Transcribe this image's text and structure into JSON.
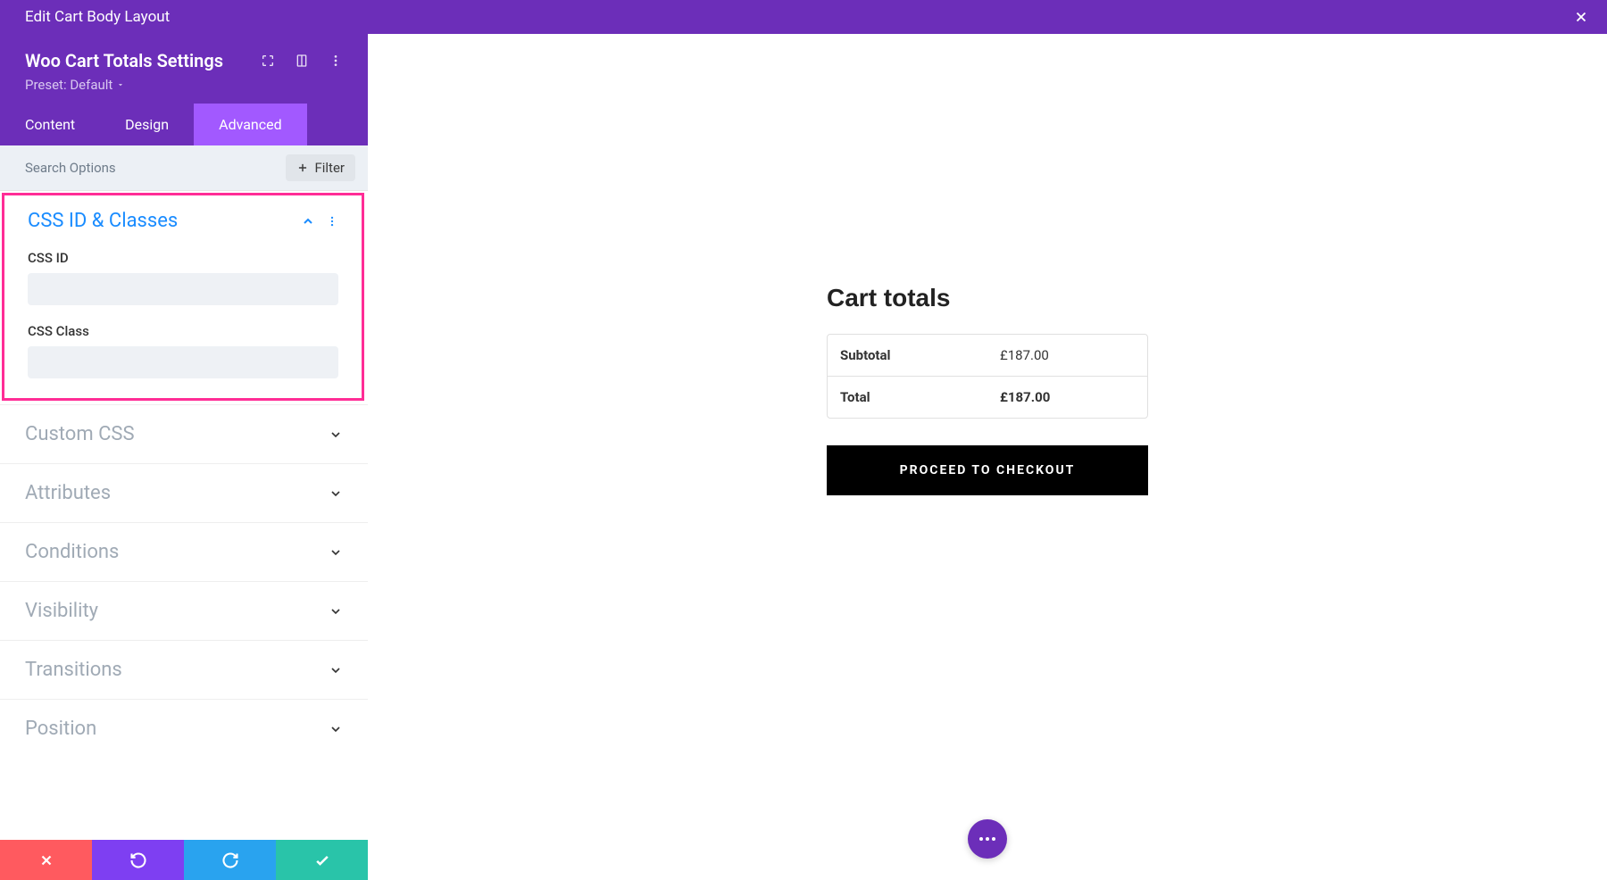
{
  "top_bar": {
    "title": "Edit Cart Body Layout"
  },
  "settings": {
    "title": "Woo Cart Totals Settings",
    "preset_label": "Preset: Default"
  },
  "tabs": {
    "content": "Content",
    "design": "Design",
    "advanced": "Advanced"
  },
  "search": {
    "placeholder": "Search Options",
    "filter": "Filter"
  },
  "section_open": {
    "title": "CSS ID & Classes",
    "css_id_label": "CSS ID",
    "css_class_label": "CSS Class"
  },
  "sections": {
    "custom_css": "Custom CSS",
    "attributes": "Attributes",
    "conditions": "Conditions",
    "visibility": "Visibility",
    "transitions": "Transitions",
    "position": "Position"
  },
  "preview": {
    "cart_title": "Cart totals",
    "subtotal_label": "Subtotal",
    "subtotal_value": "£187.00",
    "total_label": "Total",
    "total_value": "£187.00",
    "checkout_btn": "PROCEED TO CHECKOUT"
  }
}
